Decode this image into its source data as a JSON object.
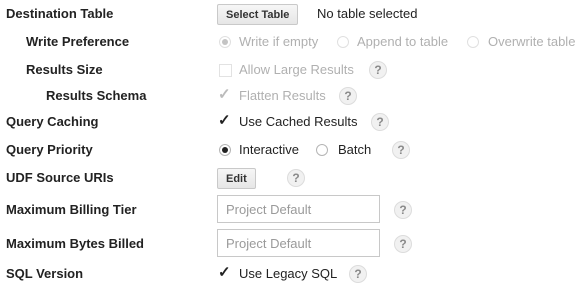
{
  "destination_table": {
    "label": "Destination Table",
    "button": "Select Table",
    "status": "No table selected"
  },
  "write_preference": {
    "label": "Write Preference",
    "options": [
      "Write if empty",
      "Append to table",
      "Overwrite table"
    ],
    "selected": "Write if empty",
    "disabled": true
  },
  "results_size": {
    "label": "Results Size",
    "option": "Allow Large Results",
    "checked": false,
    "disabled": true
  },
  "results_schema": {
    "label": "Results Schema",
    "option": "Flatten Results",
    "checked": true,
    "disabled": true
  },
  "query_caching": {
    "label": "Query Caching",
    "option": "Use Cached Results",
    "checked": true
  },
  "query_priority": {
    "label": "Query Priority",
    "options": [
      "Interactive",
      "Batch"
    ],
    "selected": "Interactive"
  },
  "udf_source_uris": {
    "label": "UDF Source URIs",
    "button": "Edit"
  },
  "max_billing_tier": {
    "label": "Maximum Billing Tier",
    "placeholder": "Project Default"
  },
  "max_bytes_billed": {
    "label": "Maximum Bytes Billed",
    "placeholder": "Project Default"
  },
  "sql_version": {
    "label": "SQL Version",
    "option": "Use Legacy SQL",
    "checked": true
  },
  "help_glyph": "?",
  "check_glyph": "✓"
}
